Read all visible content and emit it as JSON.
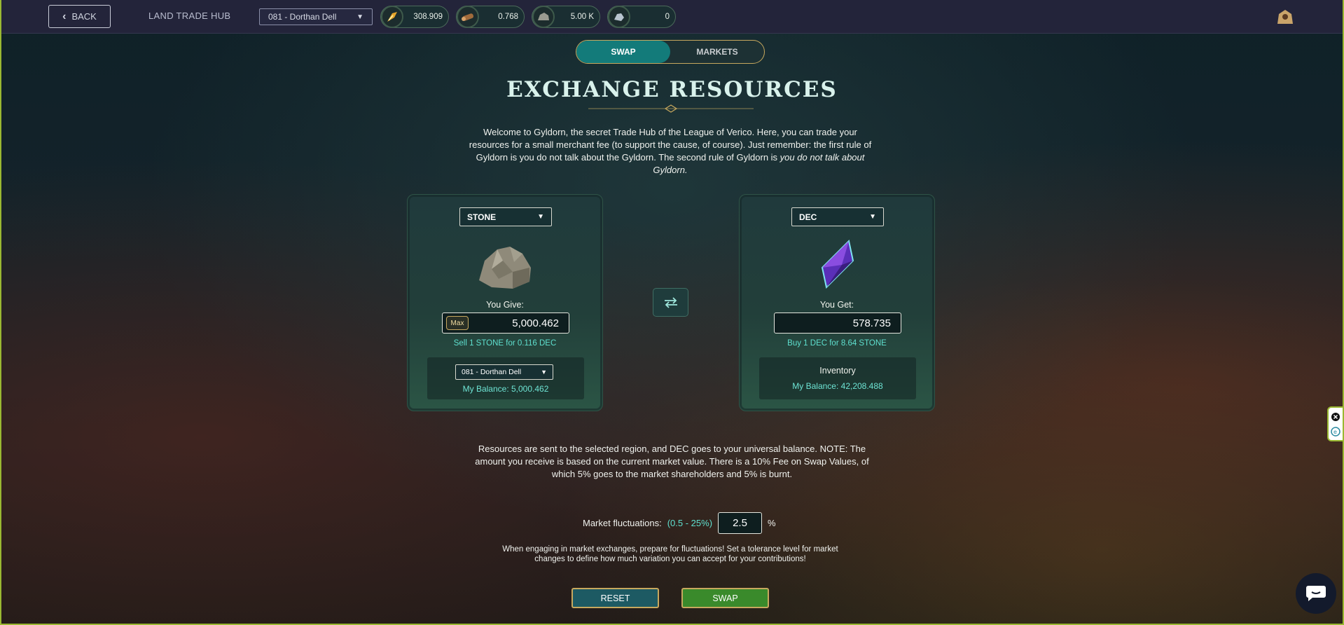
{
  "topbar": {
    "back_label": "BACK",
    "hub_title": "LAND TRADE HUB",
    "region_selected": "081 - Dorthan Dell",
    "resources": [
      {
        "icon": "grain-icon",
        "value": "308.909"
      },
      {
        "icon": "wood-icon",
        "value": "0.768"
      },
      {
        "icon": "stone-icon",
        "value": "5.00 K"
      },
      {
        "icon": "iron-icon",
        "value": "0"
      }
    ]
  },
  "tabs": [
    {
      "label": "SWAP",
      "active": true
    },
    {
      "label": "MARKETS",
      "active": false
    }
  ],
  "title": "EXCHANGE RESOURCES",
  "intro_text": "Welcome to Gyldorn, the secret Trade Hub of the League of Verico. Here, you can trade your resources for a small merchant fee (to support the cause, of course). Just remember: the first rule of Gyldorn is you do not talk about the Gyldorn. The second rule of Gyldorn is ",
  "intro_emphasis": "you do not talk about Gyldorn.",
  "give_panel": {
    "resource_selected": "STONE",
    "label": "You Give:",
    "max_label": "Max",
    "amount": "5,000.462",
    "rate": "Sell 1 STONE for 0.116 DEC",
    "region_selected": "081 - Dorthan Dell",
    "balance": "My Balance: 5,000.462"
  },
  "get_panel": {
    "resource_selected": "DEC",
    "label": "You Get:",
    "amount": "578.735",
    "rate": "Buy 1 DEC for 8.64 STONE",
    "inventory_label": "Inventory",
    "balance": "My Balance: 42,208.488"
  },
  "note_text": "Resources are sent to the selected region, and DEC goes to your universal balance. NOTE: The amount you receive is based on the current market value. There is a 10% Fee on Swap Values, of which 5% goes to the market shareholders and 5% is burnt.",
  "fluctuation": {
    "label": "Market fluctuations:",
    "range": "(0.5 - 25%)",
    "value": "2.5",
    "unit": "%"
  },
  "tolerance_text": "When engaging in market exchanges, prepare for fluctuations! Set a tolerance level for market changes to define how much variation you can accept for your contributions!",
  "buttons": {
    "reset": "RESET",
    "swap": "SWAP"
  },
  "colors": {
    "accent_teal": "#137b7a",
    "highlight_text": "#5fe0cf",
    "gold_border": "#c7a85e",
    "swap_green": "#3a8a2b",
    "topbar_bg": "#23243a"
  }
}
